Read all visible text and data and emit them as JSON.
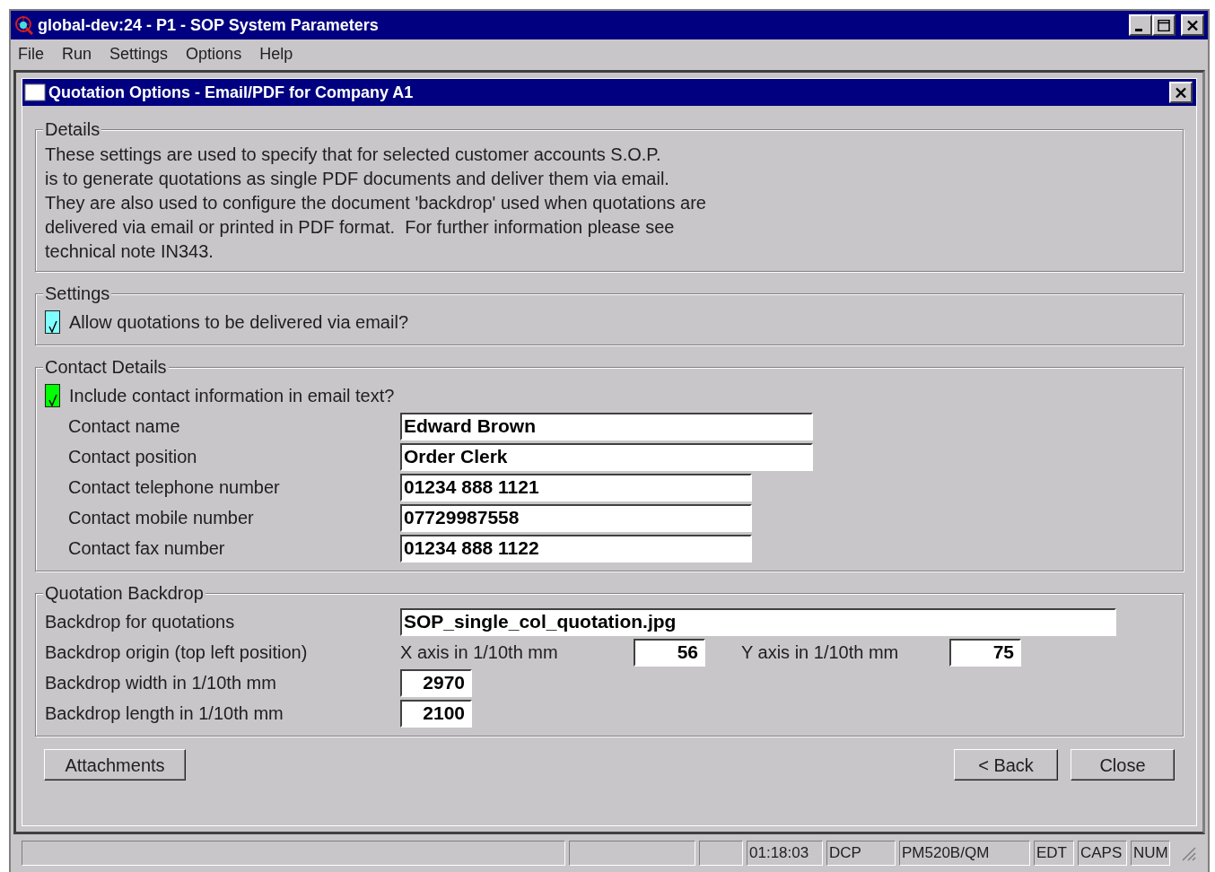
{
  "window": {
    "title": "global-dev:24 - P1 - SOP System Parameters"
  },
  "menu": [
    "File",
    "Run",
    "Settings",
    "Options",
    "Help"
  ],
  "dialog": {
    "title": "Quotation Options - Email/PDF for Company A1"
  },
  "details": {
    "legend": "Details",
    "text": "These settings are used to specify that for selected customer accounts S.O.P.\nis to generate quotations as single PDF documents and deliver them via email.\nThey are also used to configure the document 'backdrop' used when quotations are\ndelivered via email or printed in PDF format.  For further information please see\ntechnical note IN343."
  },
  "settings": {
    "legend": "Settings",
    "checkbox": {
      "label": "Allow quotations to be delivered via email?",
      "checked": true,
      "color": "#80ffff"
    }
  },
  "contact": {
    "legend": "Contact Details",
    "checkbox": {
      "label": "Include contact information in email text?",
      "checked": true,
      "color": "#00ff00"
    },
    "fields": [
      {
        "kind": "text",
        "label": "Contact name",
        "value": "Edward Brown"
      },
      {
        "kind": "text",
        "label": "Contact position",
        "value": "Order Clerk"
      },
      {
        "kind": "phone",
        "label": "Contact telephone number",
        "value": "01234 888 1121"
      },
      {
        "kind": "phone",
        "label": "Contact mobile number",
        "value": "07729987558"
      },
      {
        "kind": "phone",
        "label": "Contact fax number",
        "value": "01234 888 1122"
      }
    ]
  },
  "backdrop": {
    "legend": "Quotation Backdrop",
    "rows": [
      {
        "kind": "file",
        "label": "Backdrop for quotations",
        "value": "SOP_single_col_quotation.jpg"
      },
      {
        "kind": "xy",
        "label": "Backdrop origin (top left position)",
        "x_label": "X axis in 1/10th mm",
        "x_value": "56",
        "y_label": "Y axis in 1/10th mm",
        "y_value": "75"
      },
      {
        "kind": "number",
        "label": "Backdrop width in 1/10th mm",
        "value": "2970"
      },
      {
        "kind": "number",
        "label": "Backdrop length in 1/10th mm",
        "value": "2100"
      }
    ]
  },
  "buttons_left": [
    "Attachments"
  ],
  "buttons_right": [
    "< Back",
    "Close"
  ],
  "status_bar": {
    "panels": [
      {
        "text": "01:18:03"
      },
      {
        "text": "DCP"
      },
      {
        "text": "PM520B/QM"
      },
      {
        "text": "EDT"
      },
      {
        "text": "CAPS"
      },
      {
        "text": "NUM"
      }
    ]
  }
}
